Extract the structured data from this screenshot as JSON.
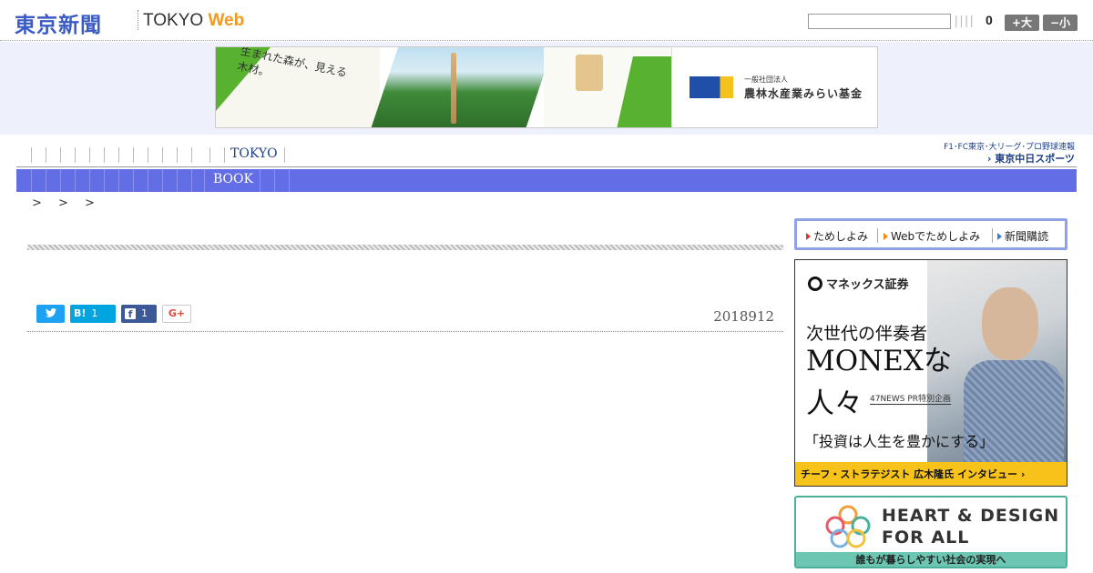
{
  "header": {
    "logo_jp": "東京新聞",
    "logo_en": "TOKYO",
    "logo_web": "Web",
    "font_count": "0",
    "font_large": "+大",
    "font_small": "−小",
    "search_value": ""
  },
  "top_banner": {
    "catch": "生まれた森が、見える木材。",
    "org_small": "一般社団法人",
    "org": "農林水産業みらい基金"
  },
  "nav": {
    "primary_label": "TOKYO",
    "secondary_label": "BOOK",
    "sports_link": "F1･FC東京･大リーグ･プロ野球速報",
    "sports_logo": "東京中日スポーツ"
  },
  "breadcrumb": "> > >",
  "article": {
    "date": "2018912",
    "share": {
      "hatena_count": "1",
      "facebook_count": "1",
      "gplus_label": "G+"
    }
  },
  "sidebar": {
    "subscribe": [
      "ためしよみ",
      "Webでためしよみ",
      "新聞購読"
    ],
    "ad1": {
      "logo": "マネックス証券",
      "sub": "次世代の伴奏者",
      "big1": "MONEXな",
      "big2": "人々",
      "tag": "47NEWS PR特別企画",
      "quote": "「投資は人生を豊かにする」",
      "footer": "チーフ・ストラテジスト 広木隆氏 インタビュー ›"
    },
    "ad2": {
      "title1": "HEART & DESIGN",
      "title2": "FOR ALL",
      "footer": "誰もが暮らしやすい社会の実現へ"
    }
  },
  "colors": {
    "brand_blue": "#3b5bc4",
    "nav_bar": "#636de6",
    "web_orange": "#f39a1d"
  },
  "icons": [
    "twitter-icon",
    "hatena-icon",
    "facebook-icon",
    "gplus-icon",
    "arrow-right-icon"
  ]
}
